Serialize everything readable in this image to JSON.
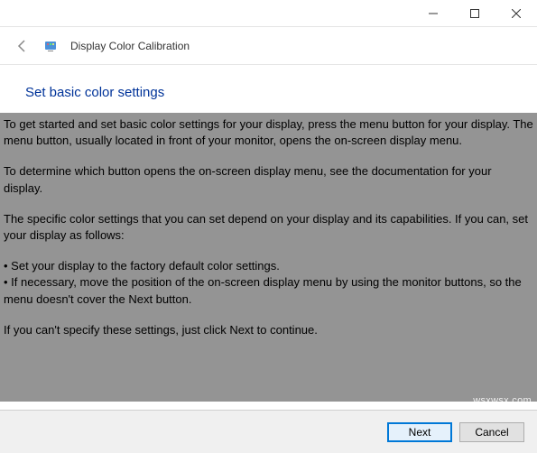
{
  "window": {
    "title": "Display Color Calibration"
  },
  "heading": "Set basic color settings",
  "paragraphs": {
    "p1": "To get started and set basic color settings for your display, press the menu button for your display. The menu button, usually located in front of your monitor, opens the on-screen display menu.",
    "p2": "To determine which button opens the on-screen display menu, see the documentation for your display.",
    "p3": "The specific color settings that you can set depend on your display and its capabilities. If you can, set your display as follows:",
    "b1": "• Set your display to the factory default color settings.",
    "b2": "• If necessary, move the position of the on-screen display menu by using the monitor buttons, so the menu doesn't cover the Next button.",
    "p4": "If you can't specify these settings,  just click Next to continue."
  },
  "buttons": {
    "next": "Next",
    "cancel": "Cancel"
  },
  "watermark": "wsxwsx.com"
}
